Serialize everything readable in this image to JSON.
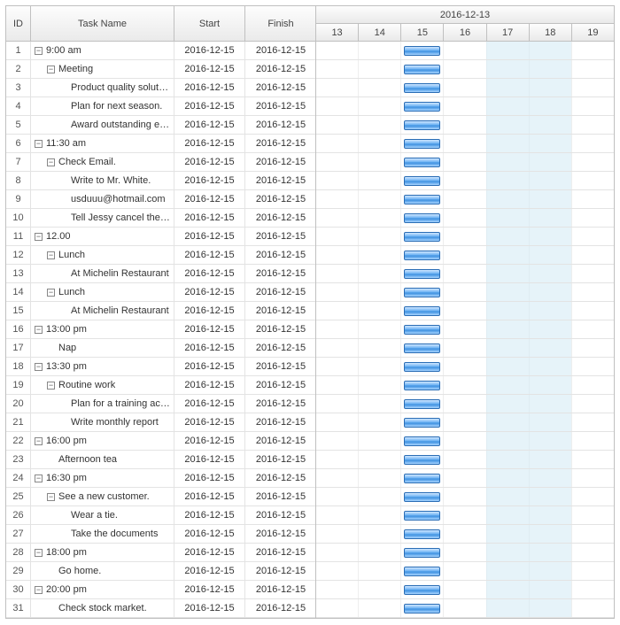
{
  "columns": {
    "id": "ID",
    "task": "Task Name",
    "start": "Start",
    "finish": "Finish"
  },
  "timeline": {
    "label": "2016-12-13",
    "ticks": [
      "13",
      "14",
      "15",
      "16",
      "17",
      "18",
      "19"
    ],
    "shade_start_index": 4,
    "shade_end_index": 6,
    "bar_tick_index": 2
  },
  "rows": [
    {
      "id": "1",
      "indent": 0,
      "toggle": true,
      "name": "9:00 am",
      "start": "2016-12-15",
      "finish": "2016-12-15"
    },
    {
      "id": "2",
      "indent": 1,
      "toggle": true,
      "name": "Meeting",
      "start": "2016-12-15",
      "finish": "2016-12-15"
    },
    {
      "id": "3",
      "indent": 2,
      "toggle": false,
      "name": "Product quality solution.",
      "start": "2016-12-15",
      "finish": "2016-12-15"
    },
    {
      "id": "4",
      "indent": 2,
      "toggle": false,
      "name": "Plan for next season.",
      "start": "2016-12-15",
      "finish": "2016-12-15"
    },
    {
      "id": "5",
      "indent": 2,
      "toggle": false,
      "name": "Award outstanding employee.",
      "start": "2016-12-15",
      "finish": "2016-12-15"
    },
    {
      "id": "6",
      "indent": 0,
      "toggle": true,
      "name": "11:30 am",
      "start": "2016-12-15",
      "finish": "2016-12-15"
    },
    {
      "id": "7",
      "indent": 1,
      "toggle": true,
      "name": "Check Email.",
      "start": "2016-12-15",
      "finish": "2016-12-15"
    },
    {
      "id": "8",
      "indent": 2,
      "toggle": false,
      "name": "Write to Mr. White.",
      "start": "2016-12-15",
      "finish": "2016-12-15"
    },
    {
      "id": "9",
      "indent": 2,
      "toggle": false,
      "name": "usduuu@hotmail.com",
      "start": "2016-12-15",
      "finish": "2016-12-15"
    },
    {
      "id": "10",
      "indent": 2,
      "toggle": false,
      "name": "Tell Jessy cancel the activity.",
      "start": "2016-12-15",
      "finish": "2016-12-15"
    },
    {
      "id": "11",
      "indent": 0,
      "toggle": true,
      "name": "12.00",
      "start": "2016-12-15",
      "finish": "2016-12-15"
    },
    {
      "id": "12",
      "indent": 1,
      "toggle": true,
      "name": "Lunch",
      "start": "2016-12-15",
      "finish": "2016-12-15"
    },
    {
      "id": "13",
      "indent": 2,
      "toggle": false,
      "name": "At Michelin Restaurant",
      "start": "2016-12-15",
      "finish": "2016-12-15"
    },
    {
      "id": "14",
      "indent": 1,
      "toggle": true,
      "name": "Lunch",
      "start": "2016-12-15",
      "finish": "2016-12-15"
    },
    {
      "id": "15",
      "indent": 2,
      "toggle": false,
      "name": "At Michelin Restaurant",
      "start": "2016-12-15",
      "finish": "2016-12-15"
    },
    {
      "id": "16",
      "indent": 0,
      "toggle": true,
      "name": "13:00 pm",
      "start": "2016-12-15",
      "finish": "2016-12-15"
    },
    {
      "id": "17",
      "indent": 1,
      "toggle": false,
      "name": "Nap",
      "start": "2016-12-15",
      "finish": "2016-12-15"
    },
    {
      "id": "18",
      "indent": 0,
      "toggle": true,
      "name": "13:30 pm",
      "start": "2016-12-15",
      "finish": "2016-12-15"
    },
    {
      "id": "19",
      "indent": 1,
      "toggle": true,
      "name": "Routine work",
      "start": "2016-12-15",
      "finish": "2016-12-15"
    },
    {
      "id": "20",
      "indent": 2,
      "toggle": false,
      "name": "Plan for a training activity",
      "start": "2016-12-15",
      "finish": "2016-12-15"
    },
    {
      "id": "21",
      "indent": 2,
      "toggle": false,
      "name": "Write monthly report",
      "start": "2016-12-15",
      "finish": "2016-12-15"
    },
    {
      "id": "22",
      "indent": 0,
      "toggle": true,
      "name": "16:00 pm",
      "start": "2016-12-15",
      "finish": "2016-12-15"
    },
    {
      "id": "23",
      "indent": 1,
      "toggle": false,
      "name": "Afternoon tea",
      "start": "2016-12-15",
      "finish": "2016-12-15"
    },
    {
      "id": "24",
      "indent": 0,
      "toggle": true,
      "name": "16:30 pm",
      "start": "2016-12-15",
      "finish": "2016-12-15"
    },
    {
      "id": "25",
      "indent": 1,
      "toggle": true,
      "name": "See a new customer.",
      "start": "2016-12-15",
      "finish": "2016-12-15"
    },
    {
      "id": "26",
      "indent": 2,
      "toggle": false,
      "name": "Wear a tie.",
      "start": "2016-12-15",
      "finish": "2016-12-15"
    },
    {
      "id": "27",
      "indent": 2,
      "toggle": false,
      "name": "Take the documents",
      "start": "2016-12-15",
      "finish": "2016-12-15"
    },
    {
      "id": "28",
      "indent": 0,
      "toggle": true,
      "name": "18:00 pm",
      "start": "2016-12-15",
      "finish": "2016-12-15"
    },
    {
      "id": "29",
      "indent": 1,
      "toggle": false,
      "name": "Go home.",
      "start": "2016-12-15",
      "finish": "2016-12-15"
    },
    {
      "id": "30",
      "indent": 0,
      "toggle": true,
      "name": "20:00 pm",
      "start": "2016-12-15",
      "finish": "2016-12-15"
    },
    {
      "id": "31",
      "indent": 1,
      "toggle": false,
      "name": "Check stock market.",
      "start": "2016-12-15",
      "finish": "2016-12-15"
    }
  ]
}
